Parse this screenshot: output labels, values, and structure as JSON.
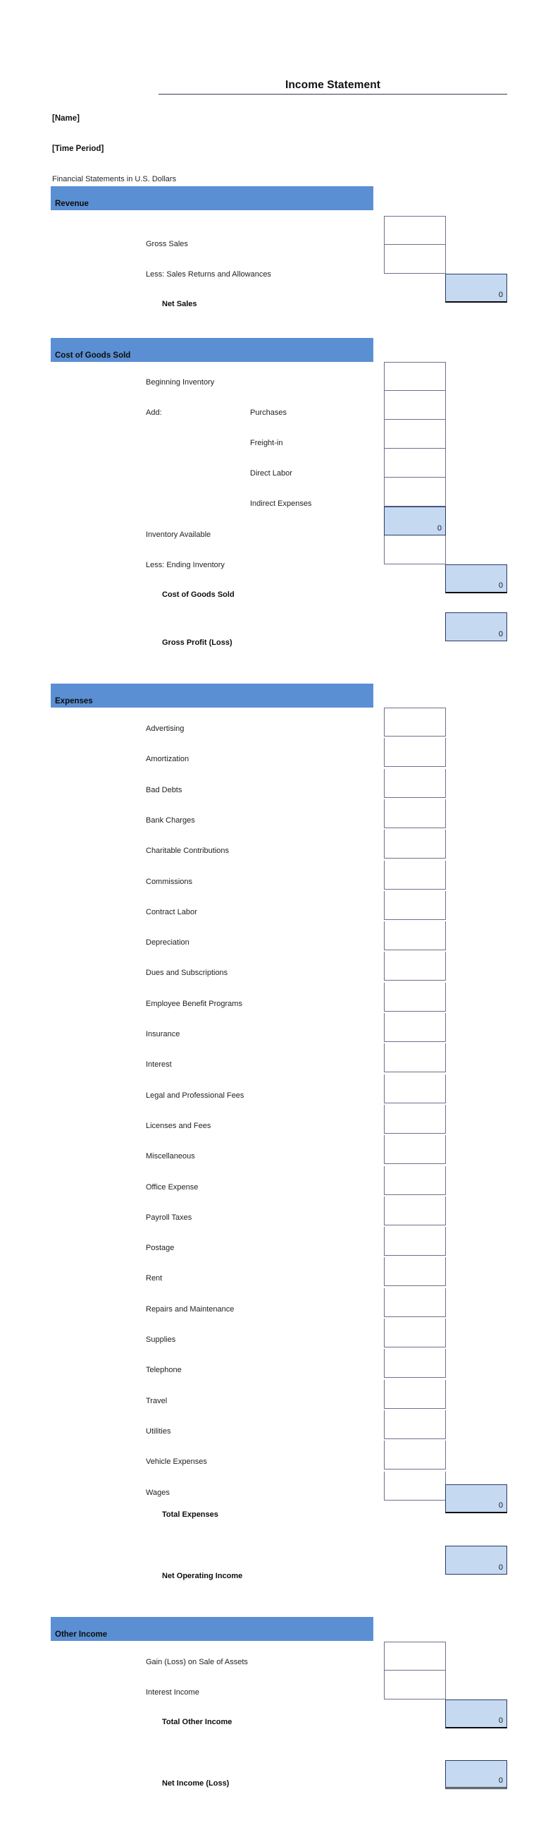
{
  "document": {
    "title": "Income Statement",
    "name_placeholder": "[Name]",
    "time_period_placeholder": "[Time Period]",
    "currency_note": "Financial Statements in U.S. Dollars"
  },
  "colors": {
    "band": "#5b8fd4",
    "calc_cell": "#c5d9f1",
    "cell_border": "#6f6f8c",
    "total_border": "#2a3a66"
  },
  "sections": {
    "revenue": {
      "header": "Revenue",
      "rows": [
        {
          "label": "Gross Sales",
          "value": ""
        },
        {
          "label": "Less: Sales Returns and Allowances",
          "value": ""
        }
      ],
      "total": {
        "label": "Net Sales",
        "value": "0"
      }
    },
    "cogs": {
      "header": "Cost of Goods Sold",
      "rows": [
        {
          "label": "Beginning Inventory",
          "value": ""
        },
        {
          "label": "Purchases",
          "value": ""
        },
        {
          "label": "Freight-in",
          "value": ""
        },
        {
          "label": "Direct Labor",
          "value": ""
        },
        {
          "label": "Indirect Expenses",
          "value": ""
        }
      ],
      "add_label": "Add:",
      "subtotal": {
        "label": "Inventory Available",
        "value": "0"
      },
      "less_ending": {
        "label": "Less: Ending Inventory",
        "value": ""
      },
      "total": {
        "label": "Cost of Goods Sold",
        "value": "0"
      },
      "gross_profit": {
        "label": "Gross Profit (Loss)",
        "value": "0"
      }
    },
    "expenses": {
      "header": "Expenses",
      "rows": [
        {
          "label": "Advertising",
          "value": ""
        },
        {
          "label": "Amortization",
          "value": ""
        },
        {
          "label": "Bad Debts",
          "value": ""
        },
        {
          "label": "Bank Charges",
          "value": ""
        },
        {
          "label": "Charitable Contributions",
          "value": ""
        },
        {
          "label": "Commissions",
          "value": ""
        },
        {
          "label": "Contract Labor",
          "value": ""
        },
        {
          "label": "Depreciation",
          "value": ""
        },
        {
          "label": "Dues and Subscriptions",
          "value": ""
        },
        {
          "label": "Employee Benefit Programs",
          "value": ""
        },
        {
          "label": "Insurance",
          "value": ""
        },
        {
          "label": "Interest",
          "value": ""
        },
        {
          "label": "Legal and Professional Fees",
          "value": ""
        },
        {
          "label": "Licenses and Fees",
          "value": ""
        },
        {
          "label": "Miscellaneous",
          "value": ""
        },
        {
          "label": "Office Expense",
          "value": ""
        },
        {
          "label": "Payroll Taxes",
          "value": ""
        },
        {
          "label": "Postage",
          "value": ""
        },
        {
          "label": "Rent",
          "value": ""
        },
        {
          "label": "Repairs and Maintenance",
          "value": ""
        },
        {
          "label": "Supplies",
          "value": ""
        },
        {
          "label": "Telephone",
          "value": ""
        },
        {
          "label": "Travel",
          "value": ""
        },
        {
          "label": "Utilities",
          "value": ""
        },
        {
          "label": "Vehicle Expenses",
          "value": ""
        },
        {
          "label": "Wages",
          "value": ""
        }
      ],
      "total": {
        "label": "Total Expenses",
        "value": "0"
      },
      "net_operating_income": {
        "label": "Net Operating Income",
        "value": "0"
      }
    },
    "other_income": {
      "header": "Other Income",
      "rows": [
        {
          "label": "Gain (Loss) on Sale of Assets",
          "value": ""
        },
        {
          "label": "Interest Income",
          "value": ""
        }
      ],
      "total": {
        "label": "Total Other Income",
        "value": "0"
      },
      "net_income": {
        "label": "Net Income (Loss)",
        "value": "0"
      }
    }
  }
}
